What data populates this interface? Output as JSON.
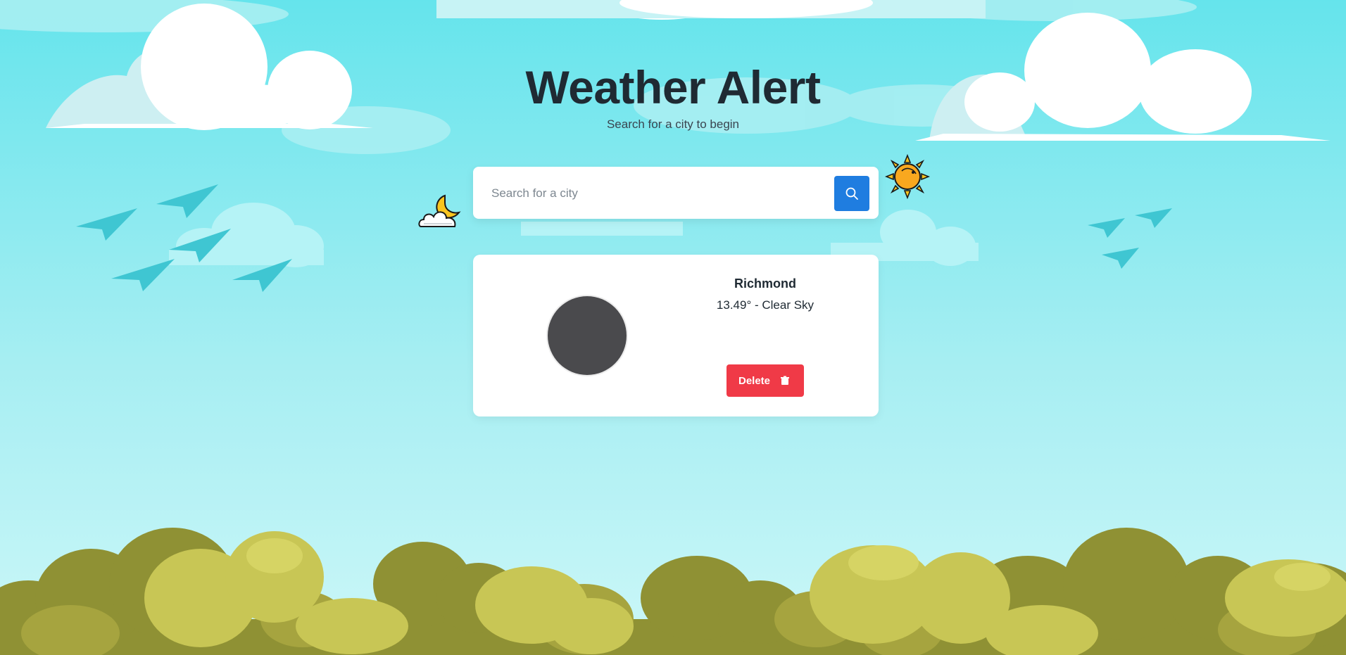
{
  "header": {
    "title": "Weather Alert",
    "subtitle": "Search for a city to begin"
  },
  "search": {
    "placeholder": "Search for a city",
    "value": "",
    "button_icon": "search-icon"
  },
  "cards": [
    {
      "city": "Richmond",
      "summary": "13.49° - Clear Sky",
      "delete_label": "Delete",
      "delete_icon": "trash-icon"
    }
  ],
  "decorations": {
    "left_icon": "moon-cloud-icon",
    "right_icon": "sun-icon"
  },
  "colors": {
    "sky_top": "#65e4ec",
    "sky_bottom": "#c9f6f8",
    "accent": "#1f7de0",
    "danger": "#f03a47",
    "text": "#1f2a33"
  }
}
